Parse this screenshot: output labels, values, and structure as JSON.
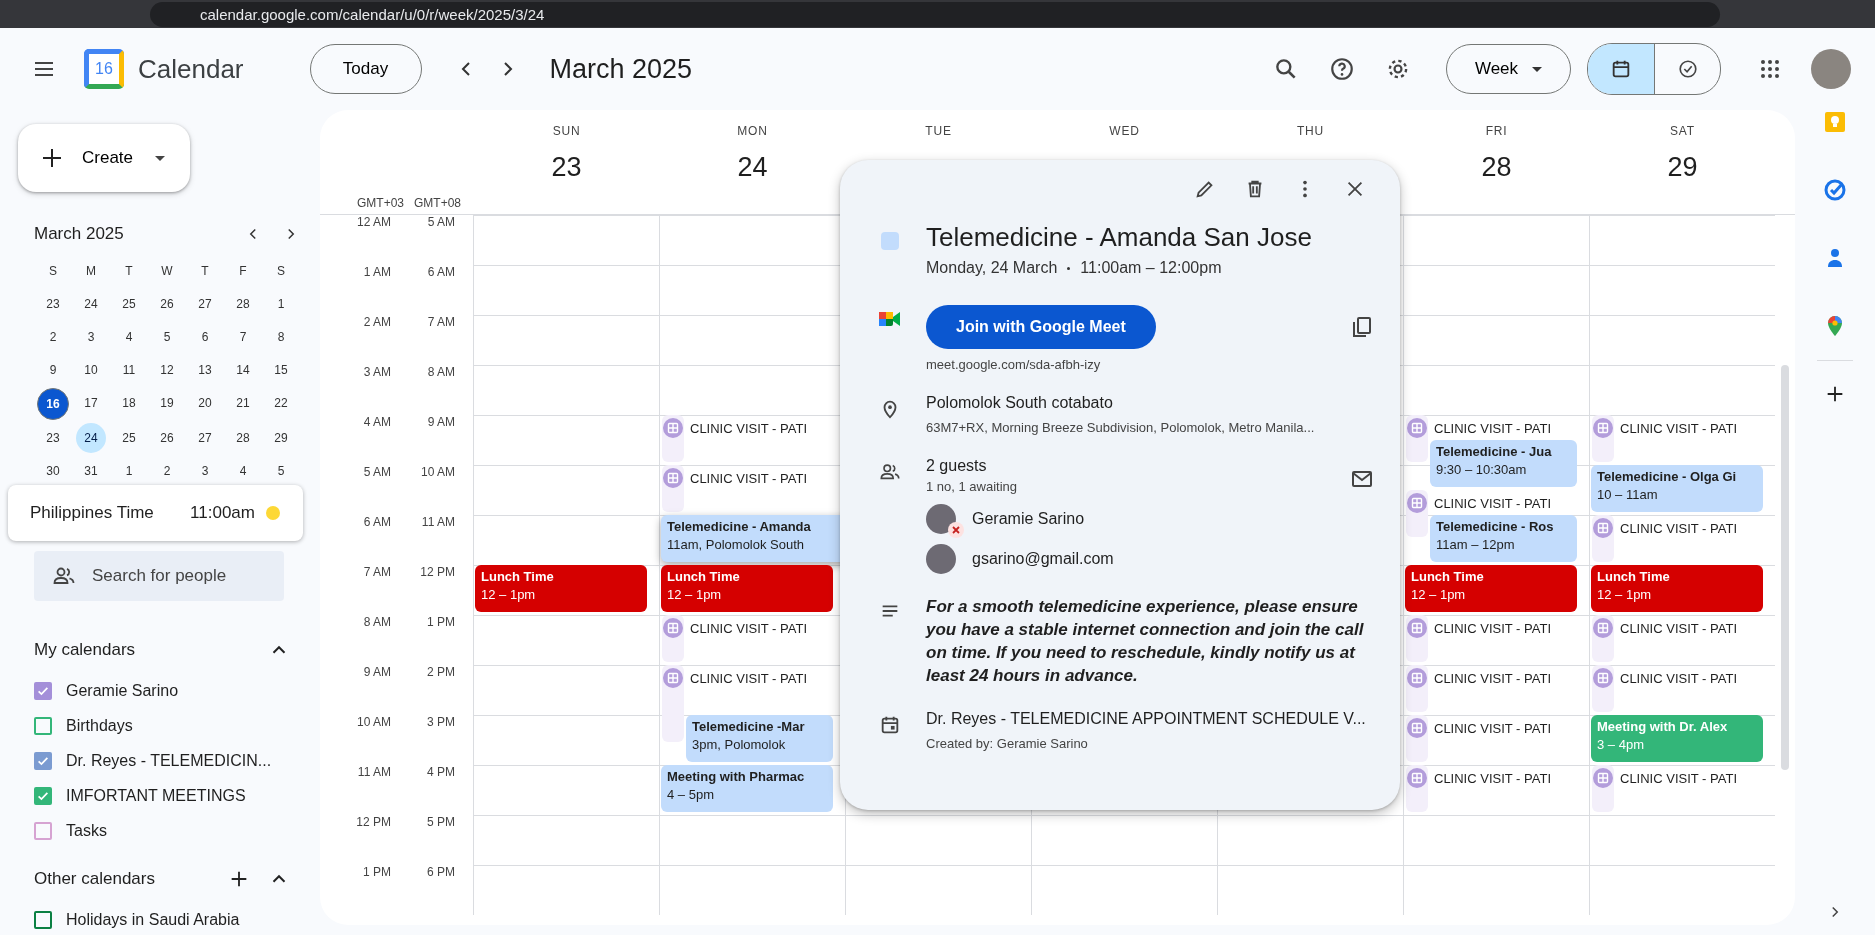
{
  "browser": {
    "url": "calendar.google.com/calendar/u/0/r/week/2025/3/24"
  },
  "header": {
    "app_name": "Calendar",
    "logo_day": "16",
    "today_button": "Today",
    "period": "March 2025",
    "view_dropdown": "Week",
    "view_toggle": [
      {
        "kind": "calendar",
        "selected": true
      },
      {
        "kind": "tasks",
        "selected": false
      }
    ]
  },
  "sidebar": {
    "create_button": "Create",
    "mini_calendar": {
      "title": "March 2025",
      "weekdays": [
        "S",
        "M",
        "T",
        "W",
        "T",
        "F",
        "S"
      ],
      "weeks": [
        [
          {
            "d": "23",
            "today": false,
            "selected": false
          },
          {
            "d": "24",
            "today": false,
            "selected": false
          },
          {
            "d": "25",
            "today": false,
            "selected": false
          },
          {
            "d": "26",
            "today": false,
            "selected": false
          },
          {
            "d": "27",
            "today": false,
            "selected": false
          },
          {
            "d": "28",
            "today": false,
            "selected": false
          },
          {
            "d": "1",
            "today": false,
            "selected": false
          }
        ],
        [
          {
            "d": "2",
            "today": false,
            "selected": false
          },
          {
            "d": "3",
            "today": false,
            "selected": false
          },
          {
            "d": "4",
            "today": false,
            "selected": false
          },
          {
            "d": "5",
            "today": false,
            "selected": false
          },
          {
            "d": "6",
            "today": false,
            "selected": false
          },
          {
            "d": "7",
            "today": false,
            "selected": false
          },
          {
            "d": "8",
            "today": false,
            "selected": false
          }
        ],
        [
          {
            "d": "9",
            "today": false,
            "selected": false
          },
          {
            "d": "10",
            "today": false,
            "selected": false
          },
          {
            "d": "11",
            "today": false,
            "selected": false
          },
          {
            "d": "12",
            "today": false,
            "selected": false
          },
          {
            "d": "13",
            "today": false,
            "selected": false
          },
          {
            "d": "14",
            "today": false,
            "selected": false
          },
          {
            "d": "15",
            "today": false,
            "selected": false
          }
        ],
        [
          {
            "d": "16",
            "today": true,
            "selected": false
          },
          {
            "d": "17",
            "today": false,
            "selected": false
          },
          {
            "d": "18",
            "today": false,
            "selected": false
          },
          {
            "d": "19",
            "today": false,
            "selected": false
          },
          {
            "d": "20",
            "today": false,
            "selected": false
          },
          {
            "d": "21",
            "today": false,
            "selected": false
          },
          {
            "d": "22",
            "today": false,
            "selected": false
          }
        ],
        [
          {
            "d": "23",
            "today": false,
            "selected": false
          },
          {
            "d": "24",
            "today": false,
            "selected": true
          },
          {
            "d": "25",
            "today": false,
            "selected": false
          },
          {
            "d": "26",
            "today": false,
            "selected": false
          },
          {
            "d": "27",
            "today": false,
            "selected": false
          },
          {
            "d": "28",
            "today": false,
            "selected": false
          },
          {
            "d": "29",
            "today": false,
            "selected": false
          }
        ],
        [
          {
            "d": "30",
            "today": false,
            "selected": false
          },
          {
            "d": "31",
            "today": false,
            "selected": false
          },
          {
            "d": "1",
            "today": false,
            "selected": false
          },
          {
            "d": "2",
            "today": false,
            "selected": false
          },
          {
            "d": "3",
            "today": false,
            "selected": false
          },
          {
            "d": "4",
            "today": false,
            "selected": false
          },
          {
            "d": "5",
            "today": false,
            "selected": false
          }
        ]
      ]
    },
    "time_card": {
      "zone": "Philippines Time",
      "time": "11:00am"
    },
    "search": {
      "placeholder": "Search for people"
    },
    "my_calendars": {
      "title": "My calendars",
      "items": [
        {
          "label": "Geramie Sarino",
          "checked": true,
          "color": "#a48fd9"
        },
        {
          "label": "Birthdays",
          "checked": false,
          "color": "#33b679"
        },
        {
          "label": "Dr. Reyes - TELEMEDICIN...",
          "checked": true,
          "color": "#7b9bd1"
        },
        {
          "label": "IMFORTANT MEETINGS",
          "checked": true,
          "color": "#33b679"
        },
        {
          "label": "Tasks",
          "checked": false,
          "color": "#d6a3d2"
        }
      ]
    },
    "other_calendars": {
      "title": "Other calendars",
      "items": [
        {
          "label": "Holidays in Saudi Arabia",
          "checked": false,
          "color": "#0b8043"
        }
      ]
    }
  },
  "week": {
    "timezones": [
      "GMT+03",
      "GMT+08"
    ],
    "hours": [
      [
        "12 AM",
        "5 AM"
      ],
      [
        "1 AM",
        "6 AM"
      ],
      [
        "2 AM",
        "7 AM"
      ],
      [
        "3 AM",
        "8 AM"
      ],
      [
        "4 AM",
        "9 AM"
      ],
      [
        "5 AM",
        "10 AM"
      ],
      [
        "6 AM",
        "11 AM"
      ],
      [
        "7 AM",
        "12 PM"
      ],
      [
        "8 AM",
        "1 PM"
      ],
      [
        "9 AM",
        "2 PM"
      ],
      [
        "10 AM",
        "3 PM"
      ],
      [
        "11 AM",
        "4 PM"
      ],
      [
        "12 PM",
        "5 PM"
      ],
      [
        "1 PM",
        "6 PM"
      ]
    ],
    "days": [
      {
        "name": "SUN",
        "date": "23",
        "events": [
          {
            "kind": "event",
            "title": "Lunch Time",
            "time": "12 – 1pm",
            "color": "#d50000",
            "overlapping": false,
            "selected": false
          }
        ]
      },
      {
        "name": "MON",
        "date": "24",
        "events": [
          {
            "kind": "appointment",
            "title": "CLINIC VISIT - PATI"
          },
          {
            "kind": "appointment",
            "title": "CLINIC VISIT - PATI"
          },
          {
            "kind": "event",
            "title": "Telemedicine - Amanda",
            "time": "11am, Polomolok South",
            "color": "#c2dcfc",
            "overlapping": false,
            "selected": true
          },
          {
            "kind": "event",
            "title": "Lunch Time",
            "time": "12 – 1pm",
            "color": "#d50000",
            "overlapping": false,
            "selected": false
          },
          {
            "kind": "appointment",
            "title": "CLINIC VISIT - PATI"
          },
          {
            "kind": "appointment",
            "title": "CLINIC VISIT - PATI"
          },
          {
            "kind": "event",
            "title": "Telemedicine -Mar",
            "time": "3pm, Polomolok",
            "color": "#c2dcfc",
            "overlapping": true,
            "selected": false
          },
          {
            "kind": "event",
            "title": "Meeting with Pharmac",
            "time": "4 – 5pm",
            "color": "#c2dcfc",
            "overlapping": false,
            "selected": false
          }
        ]
      },
      {
        "name": "TUE"
      },
      {
        "name": "WED"
      },
      {
        "name": "THU"
      },
      {
        "name": "FRI",
        "date": "28",
        "events": [
          {
            "kind": "appointment",
            "title": "CLINIC VISIT - PATI"
          },
          {
            "kind": "event",
            "title": "Telemedicine - Jua",
            "time": "9:30 – 10:30am",
            "color": "#c2dcfc",
            "overlapping": true,
            "selected": false
          },
          {
            "kind": "appointment",
            "title": "CLINIC VISIT - PATI"
          },
          {
            "kind": "event",
            "title": "Telemedicine - Ros",
            "time": "11am – 12pm",
            "color": "#c2dcfc",
            "overlapping": true,
            "selected": false
          },
          {
            "kind": "event",
            "title": "Lunch Time",
            "time": "12 – 1pm",
            "color": "#d50000",
            "overlapping": false,
            "selected": false
          },
          {
            "kind": "appointment",
            "title": "CLINIC VISIT - PATI"
          },
          {
            "kind": "appointment",
            "title": "CLINIC VISIT - PATI"
          },
          {
            "kind": "appointment",
            "title": "CLINIC VISIT - PATI"
          },
          {
            "kind": "appointment",
            "title": "CLINIC VISIT - PATI"
          }
        ]
      },
      {
        "name": "SAT",
        "date": "29",
        "events": [
          {
            "kind": "appointment",
            "title": "CLINIC VISIT - PATI"
          },
          {
            "kind": "event",
            "title": "Telemedicine - Olga Gi",
            "time": "10 – 11am",
            "color": "#c2dcfc",
            "overlapping": false,
            "selected": false
          },
          {
            "kind": "appointment",
            "title": "CLINIC VISIT - PATI"
          },
          {
            "kind": "event",
            "title": "Lunch Time",
            "time": "12 – 1pm",
            "color": "#d50000",
            "overlapping": false,
            "selected": false
          },
          {
            "kind": "appointment",
            "title": "CLINIC VISIT - PATI"
          },
          {
            "kind": "appointment",
            "title": "CLINIC VISIT - PATI"
          },
          {
            "kind": "event",
            "title": "Meeting with Dr. Alex",
            "time": "3 – 4pm",
            "color": "#33b679",
            "overlapping": false,
            "selected": false
          },
          {
            "kind": "appointment",
            "title": "CLINIC VISIT - PATI"
          }
        ]
      }
    ]
  },
  "event_popup": {
    "color": "#c2dcfc",
    "title": "Telemedicine - Amanda San Jose",
    "date": "Monday, 24 March",
    "time": "11:00am – 12:00pm",
    "meet_button": "Join with Google Meet",
    "meet_link": "meet.google.com/sda-afbh-izy",
    "location": "Polomolok South cotabato",
    "address": "63M7+RX, Morning Breeze Subdivision, Polomolok, Metro Manila...",
    "guests_title": "2 guests",
    "guests_summary": "1 no, 1 awaiting",
    "guests": [
      {
        "name": "Geramie Sarino",
        "declined": true
      },
      {
        "name": "gsarino@gmail.com",
        "declined": false
      }
    ],
    "description": "For a smooth telemedicine experience, please ensure you have a stable internet connection and join the call on time. If you need to reschedule, kindly notify us at least 24 hours in advance.",
    "calendar": "Dr. Reyes - TELEMEDICINE APPOINTMENT SCHEDULE V...",
    "creator": "Created by: Geramie Sarino"
  }
}
